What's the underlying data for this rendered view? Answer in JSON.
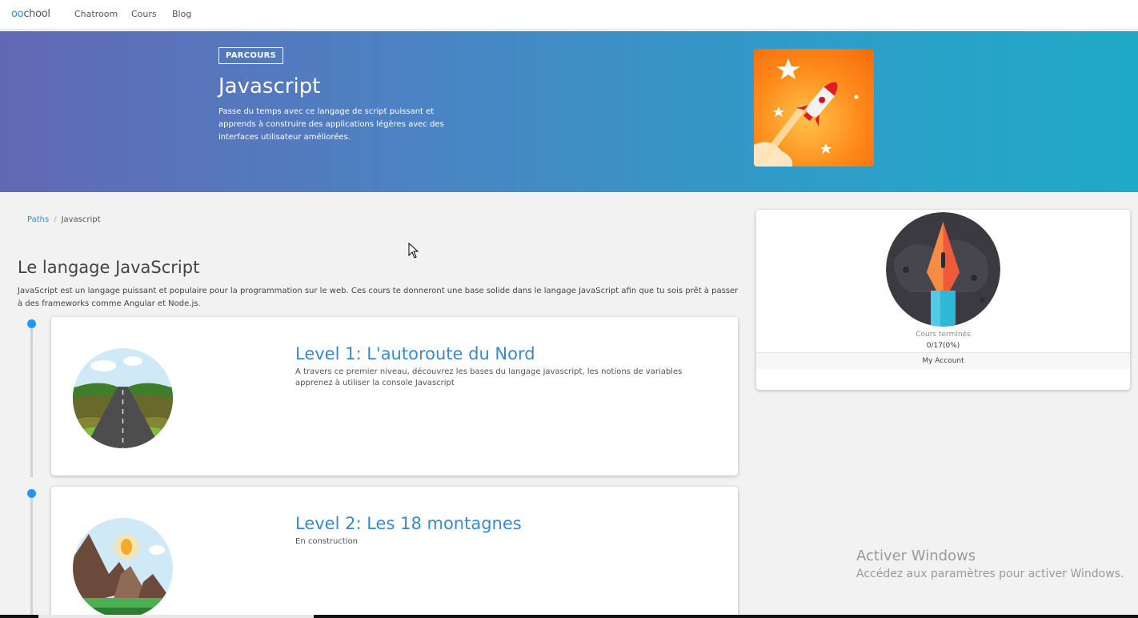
{
  "nav": {
    "logo_prefix": "oo",
    "logo_suffix": "chool",
    "links": [
      "Chatroom",
      "Cours",
      "Blog"
    ]
  },
  "hero": {
    "badge": "PARCOURS",
    "title": "Javascript",
    "description": "Passe du temps avec ce langage de script puissant et apprends à construire des applications légères avec des interfaces utilisateur améliorées.",
    "image_icon": "rocket-icon"
  },
  "breadcrumb": {
    "root": "Paths",
    "separator": "/",
    "current": "Javascript"
  },
  "section": {
    "title": "Le langage JavaScript",
    "description": "JavaScript est un langage puissant et populaire pour la programmation sur le web. Ces cours te donneront une base solide dans le langage JavaScript afin que tu sois prêt à passer à des frameworks comme Angular et Node.js."
  },
  "levels": [
    {
      "title": "Level 1: L'autoroute du Nord",
      "description": "A travers ce premier niveau, découvrez les bases du langage javascript, les notions de variables apprenez à utiliser la console Javascript",
      "image_icon": "road-illustration"
    },
    {
      "title": "Level 2: Les 18 montagnes",
      "description": "En construction",
      "image_icon": "mountains-illustration"
    }
  ],
  "account": {
    "avatar_icon": "pen-nib-icon",
    "stats_label": "Cours terminés",
    "stats_value": "0/17(0%)",
    "link": "My Account"
  },
  "watermark": {
    "title": "Activer Windows",
    "subtitle": "Accédez aux paramètres pour activer Windows."
  },
  "colors": {
    "accent": "#2f8fd8",
    "link": "#3a8ac8",
    "timeline_dot": "#2196f3",
    "hero_gradient_start": "#6368b5",
    "hero_gradient_end": "#20aac7"
  }
}
